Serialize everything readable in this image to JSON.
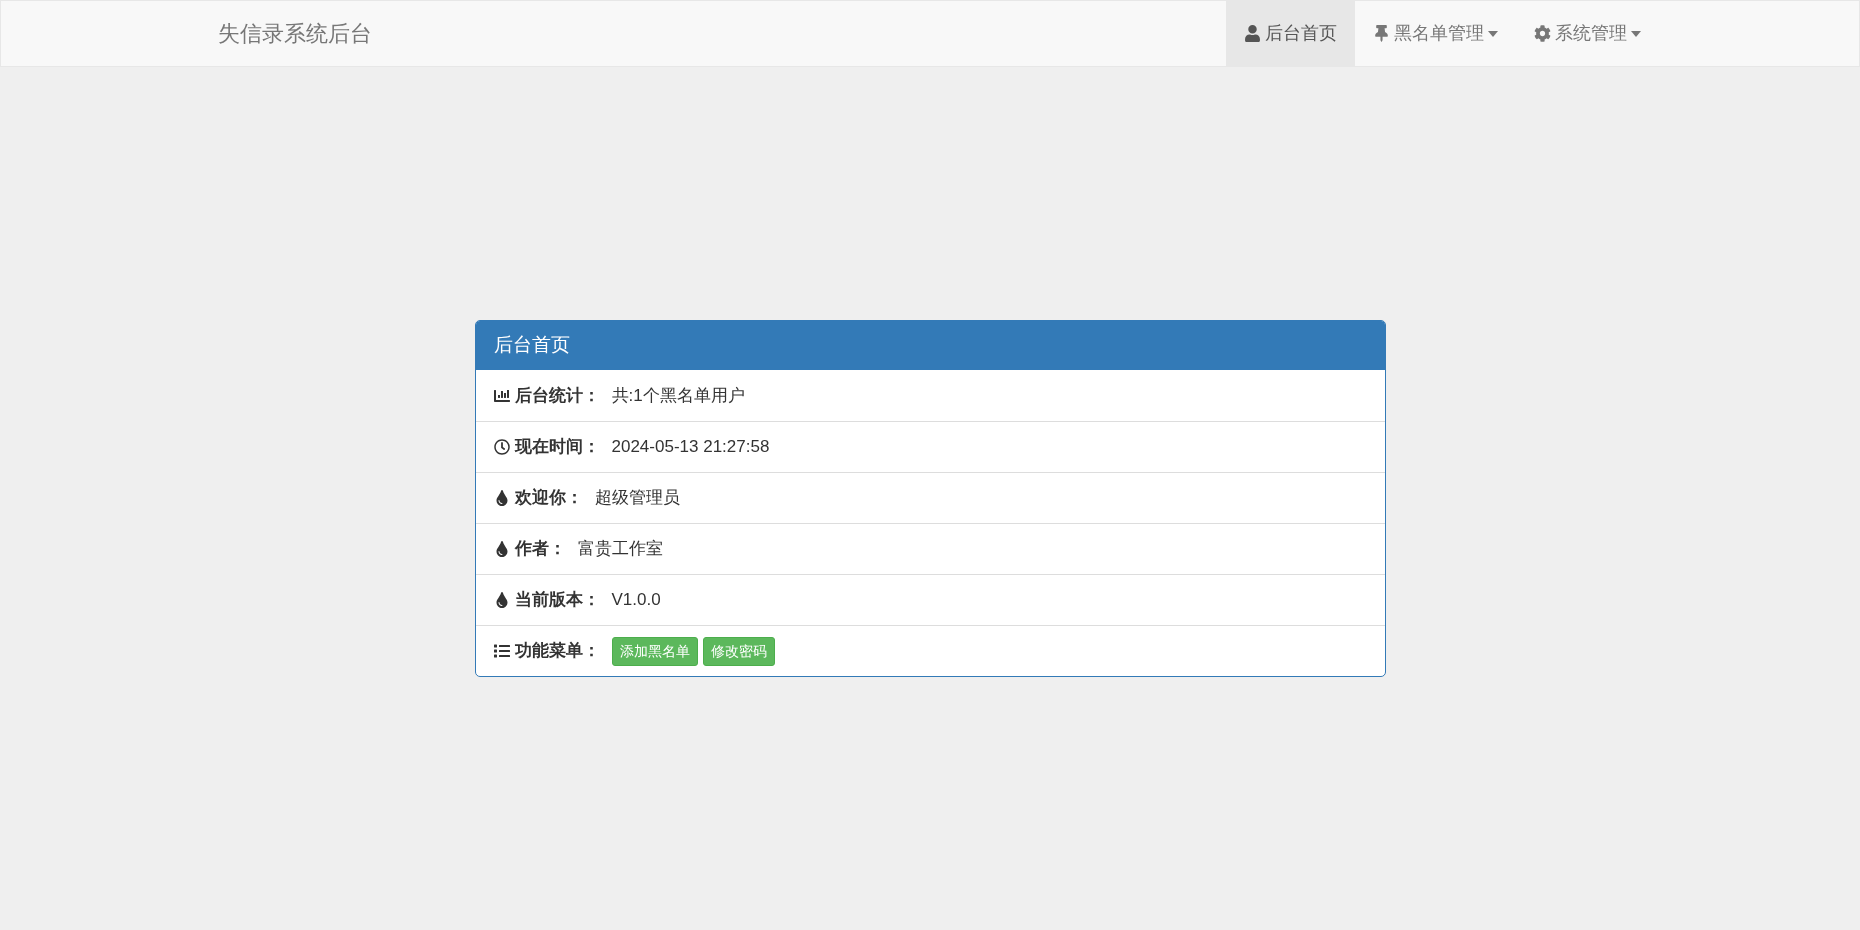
{
  "navbar": {
    "brand": "失信录系统后台",
    "items": [
      {
        "label": "后台首页",
        "dropdown": false,
        "selected": true
      },
      {
        "label": "黑名单管理",
        "dropdown": true,
        "selected": false
      },
      {
        "label": "系统管理",
        "dropdown": true,
        "selected": false
      }
    ]
  },
  "panel": {
    "title": "后台首页",
    "rows": [
      {
        "kind": "text",
        "label": "后台统计：",
        "value": "共:1个黑名单用户"
      },
      {
        "kind": "text",
        "label": "现在时间：",
        "value": "2024-05-13 21:27:58"
      },
      {
        "kind": "text",
        "label": "欢迎你：",
        "value": "超级管理员"
      },
      {
        "kind": "text",
        "label": "作者：",
        "value": "富贵工作室"
      },
      {
        "kind": "text",
        "label": "当前版本：",
        "value": "V1.0.0"
      },
      {
        "kind": "buttons",
        "label": "功能菜单：",
        "buttons": [
          "添加黑名单",
          "修改密码"
        ]
      }
    ]
  }
}
